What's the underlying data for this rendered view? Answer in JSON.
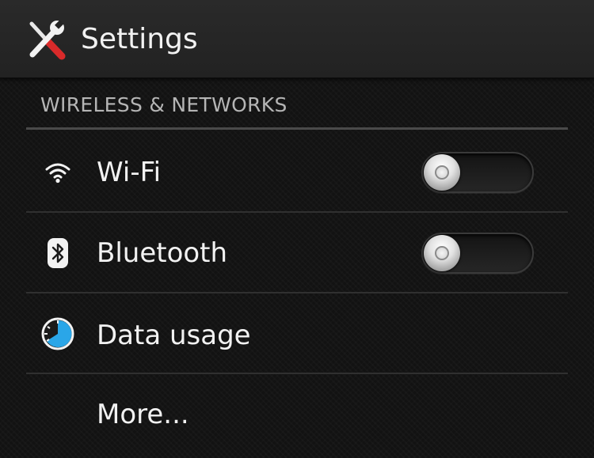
{
  "header": {
    "title": "Settings",
    "icon": "settings-tools-icon"
  },
  "section": {
    "title": "WIRELESS & NETWORKS"
  },
  "items": [
    {
      "label": "Wi-Fi",
      "icon": "wifi-icon",
      "toggle": "off"
    },
    {
      "label": "Bluetooth",
      "icon": "bluetooth-icon",
      "toggle": "off"
    },
    {
      "label": "Data usage",
      "icon": "data-usage-icon"
    },
    {
      "label": "More..."
    }
  ],
  "colors": {
    "background": "#121212",
    "action_bar": "#252525",
    "section_text": "#b5b5b5",
    "accent_blue": "#2aa6e8",
    "tool_red": "#d92a2a"
  }
}
